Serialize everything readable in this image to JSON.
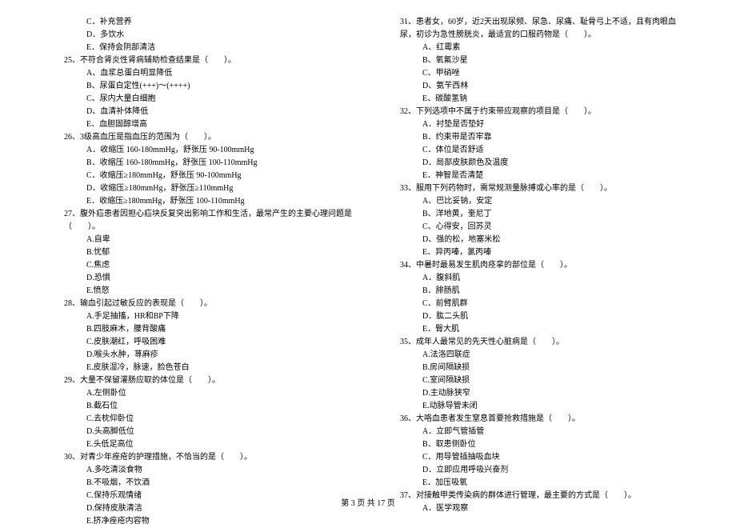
{
  "left_column": [
    {
      "type": "option",
      "text": "C．补充营养"
    },
    {
      "type": "option",
      "text": "D．多饮水"
    },
    {
      "type": "option",
      "text": "E．保持会阴部清洁"
    },
    {
      "type": "question",
      "text": "25、不符合肾炎性肾病辅助检查结果是（　　）。"
    },
    {
      "type": "option",
      "text": "A、血浆总蛋白明显降低"
    },
    {
      "type": "option",
      "text": "B、尿蛋白定性(+++)～(++++)"
    },
    {
      "type": "option",
      "text": "C、尿内大量白细胞"
    },
    {
      "type": "option",
      "text": "D、血清补体降低"
    },
    {
      "type": "option",
      "text": "E、血胆固醇增高"
    },
    {
      "type": "question",
      "text": "26、3级高血压是指血压的范围为（　　）。"
    },
    {
      "type": "option",
      "text": "A．收缩压 160-180mmHg，舒张压 90-100mmHg"
    },
    {
      "type": "option",
      "text": "B．收缩压 160-180mmHg，舒张压 100-110mmHg"
    },
    {
      "type": "option",
      "text": "C．收缩压≥180mmHg，舒张压 90-100mmHg"
    },
    {
      "type": "option",
      "text": "D．收缩压≥180mmHg，舒张压≥110mmHg"
    },
    {
      "type": "option",
      "text": "E．收缩压≥180mmHg，舒张压 100-110mmHg"
    },
    {
      "type": "question",
      "text": "27、腹外疝患者因担心疝块反复突出影响工作和生活，最常产生的主要心理问题是（　　）。"
    },
    {
      "type": "option",
      "text": "A.自卑"
    },
    {
      "type": "option",
      "text": "B.忧郁"
    },
    {
      "type": "option",
      "text": "C.焦虑"
    },
    {
      "type": "option",
      "text": "D.恐惧"
    },
    {
      "type": "option",
      "text": "E.愤怒"
    },
    {
      "type": "question",
      "text": "28、输血引起过敏反应的表现是（　　）。"
    },
    {
      "type": "option",
      "text": "A.手足抽搐，HR和BP下降"
    },
    {
      "type": "option",
      "text": "B.四肢麻木，腰背酸痛"
    },
    {
      "type": "option",
      "text": "C.皮肤潮红，呼吸困难"
    },
    {
      "type": "option",
      "text": "D.喉头水肿，荨麻疹"
    },
    {
      "type": "option",
      "text": "E.皮肤湿冷，脉速，脸色苍白"
    },
    {
      "type": "question",
      "text": "29、大量不保留灌肠应取的体位是（　　）。"
    },
    {
      "type": "option",
      "text": "A.左侧卧位"
    },
    {
      "type": "option",
      "text": "B.截石位"
    },
    {
      "type": "option",
      "text": "C.去枕仰卧位"
    },
    {
      "type": "option",
      "text": "D.头高脚低位"
    },
    {
      "type": "option",
      "text": "E.头低足高位"
    },
    {
      "type": "question",
      "text": "30、对青少年痤疮的护理措施，不恰当的是（　　）。"
    },
    {
      "type": "option",
      "text": "A.多吃清淡食物"
    },
    {
      "type": "option",
      "text": "B.不吸烟，不饮酒"
    },
    {
      "type": "option",
      "text": "C.保持乐观情绪"
    },
    {
      "type": "option",
      "text": "D.保持皮肤清洁"
    },
    {
      "type": "option",
      "text": "E.挤净痤疮内容物"
    }
  ],
  "right_column": [
    {
      "type": "question",
      "text": "31、患者女，60岁，近2天出现尿频、尿急、尿痛、耻骨弓上不适，且有肉眼血尿，初诊为急性膀胱炎，最适宜的口服药物是（　　）。"
    },
    {
      "type": "option",
      "text": "A、红霉素"
    },
    {
      "type": "option",
      "text": "B、氧氟沙星"
    },
    {
      "type": "option",
      "text": "C、甲硝唑"
    },
    {
      "type": "option",
      "text": "D、氨苄西林"
    },
    {
      "type": "option",
      "text": "E、碳酸氢钠"
    },
    {
      "type": "question",
      "text": "32、下列选项中不属于约束带应观察的项目是（　　）。"
    },
    {
      "type": "option",
      "text": "A．衬垫是否垫好"
    },
    {
      "type": "option",
      "text": "B．约束带是否牢靠"
    },
    {
      "type": "option",
      "text": "C．体位是否舒适"
    },
    {
      "type": "option",
      "text": "D．局部皮肤颜色及温度"
    },
    {
      "type": "option",
      "text": "E．神智是否清楚"
    },
    {
      "type": "question",
      "text": "33、服用下列药物时，需常规测量脉搏或心率的是（　　）。"
    },
    {
      "type": "option",
      "text": "A、巴比妥钠，安定"
    },
    {
      "type": "option",
      "text": "B、洋地黄，奎尼丁"
    },
    {
      "type": "option",
      "text": "C、心得安，回苏灵"
    },
    {
      "type": "option",
      "text": "D、强的松，地塞米松"
    },
    {
      "type": "option",
      "text": "E、异丙嗪，氯丙嗪"
    },
    {
      "type": "question",
      "text": "34、中暑时最易发生肌肉痉挛的部位是（　　）。"
    },
    {
      "type": "option",
      "text": "A．腹斜肌"
    },
    {
      "type": "option",
      "text": "B．腓肠肌"
    },
    {
      "type": "option",
      "text": "C．前臂肌群"
    },
    {
      "type": "option",
      "text": "D．肱二头肌"
    },
    {
      "type": "option",
      "text": "E．臀大肌"
    },
    {
      "type": "question",
      "text": "35、成年人最常见的先天性心脏病是（　　）。"
    },
    {
      "type": "option",
      "text": "A.法洛四联症"
    },
    {
      "type": "option",
      "text": "B.房间隔缺损"
    },
    {
      "type": "option",
      "text": "C.室间隔缺损"
    },
    {
      "type": "option",
      "text": "D.主动脉狭窄"
    },
    {
      "type": "option",
      "text": "E.动脉导管未闭"
    },
    {
      "type": "question",
      "text": "36、大咯血患者发生窒息首要抢救措施是（　　）。"
    },
    {
      "type": "option",
      "text": "A．立即气管插管"
    },
    {
      "type": "option",
      "text": "B．取患侧卧位"
    },
    {
      "type": "option",
      "text": "C．用导管插抽吸血块"
    },
    {
      "type": "option",
      "text": "D．立即应用呼吸兴奋剂"
    },
    {
      "type": "option",
      "text": "E．加压吸氧"
    },
    {
      "type": "question",
      "text": "37、对接触甲类传染病的群体进行管理，最主要的方式是（　　）。"
    },
    {
      "type": "option",
      "text": "A．医学观察"
    }
  ],
  "footer": "第 3 页 共 17 页"
}
